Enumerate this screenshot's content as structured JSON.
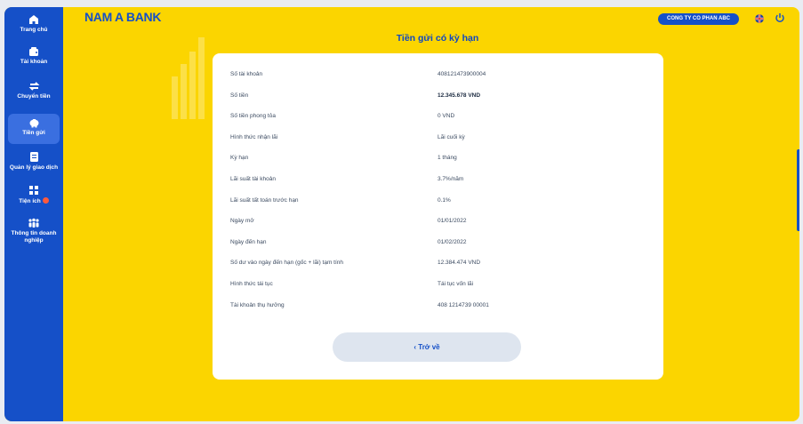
{
  "app": {
    "brand": "NAM A BANK",
    "company": "CONG TY CO PHAN ABC"
  },
  "sidebar": {
    "items": [
      {
        "label": "Trang chủ",
        "icon": "home-icon"
      },
      {
        "label": "Tài khoản",
        "icon": "wallet-icon"
      },
      {
        "label": "Chuyển tiền",
        "icon": "transfer-icon"
      },
      {
        "label": "Tiền gửi",
        "icon": "piggy-bank-icon",
        "active": true
      },
      {
        "label": "Quản lý giao dịch",
        "icon": "document-icon"
      },
      {
        "label": "Tiện ích",
        "icon": "grid-icon"
      },
      {
        "label": "Thông tin doanh nghiệp",
        "icon": "people-icon"
      }
    ]
  },
  "page": {
    "title": "Tiền gửi có kỳ hạn"
  },
  "details": [
    {
      "label": "Số tài khoản",
      "value": "408121473900004"
    },
    {
      "label": "Số tiền",
      "value": "12.345.678 VND"
    },
    {
      "label": "Số tiền phong tỏa",
      "value": "0 VND"
    },
    {
      "label": "Hình thức nhận lãi",
      "value": "Lãi cuối kỳ"
    },
    {
      "label": "Kỳ hạn",
      "value": "1 tháng"
    },
    {
      "label": "Lãi suất tài khoản",
      "value": "3.7%/năm"
    },
    {
      "label": "Lãi suất tất toán trước hạn",
      "value": "0.1%"
    },
    {
      "label": "Ngày mở",
      "value": "01/01/2022"
    },
    {
      "label": "Ngày đến hạn",
      "value": "01/02/2022"
    },
    {
      "label": "Số dư vào ngày đến hạn (gốc + lãi) tạm tính",
      "value": "12.384.474 VND"
    },
    {
      "label": "Hình thức tái tục",
      "value": "Tái tục vốn lãi"
    },
    {
      "label": "Tài khoản thụ hưởng",
      "value": "408 1214739 00001"
    }
  ],
  "actions": {
    "back_label": "‹  Trở về"
  },
  "colors": {
    "brand_blue": "#1550c8",
    "background_yellow": "#fbd500",
    "card": "#ffffff"
  }
}
